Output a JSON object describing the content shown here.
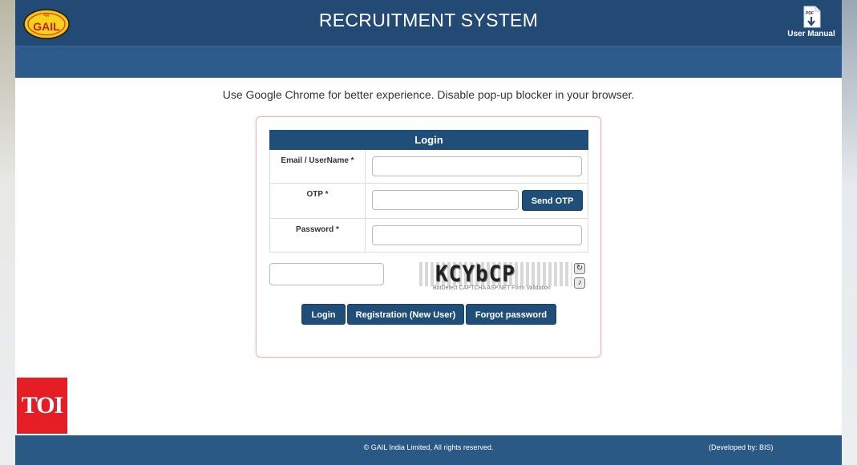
{
  "header": {
    "logo_text_top": "गेल",
    "logo_text": "GAIL",
    "title": "RECRUITMENT SYSTEM",
    "manual_icon_text": "PDF",
    "manual_label": "User Manual"
  },
  "notice": "Use Google Chrome for better experience. Disable pop-up blocker in your browser.",
  "login": {
    "heading": "Login",
    "email_label": "Email / UserName *",
    "otp_label": "OTP *",
    "password_label": "Password *",
    "send_otp": "Send OTP",
    "captcha_code": "KCYbCP",
    "captcha_caption": "BotDetect CAPTCHA ASP.NET Form Validation",
    "buttons": {
      "login": "Login",
      "register": "Registration (New User)",
      "forgot": "Forgot password"
    }
  },
  "watermark": "TOI",
  "footer": {
    "copyright": "© GAIL India Limited, All rights reserved.",
    "developer": "(Developed by: BIS)"
  },
  "colors": {
    "header": "#234a75",
    "subbar": "#2d5c8c",
    "button": "#1f4e79",
    "footer": "#2b5985",
    "watermark": "#e51d25"
  }
}
